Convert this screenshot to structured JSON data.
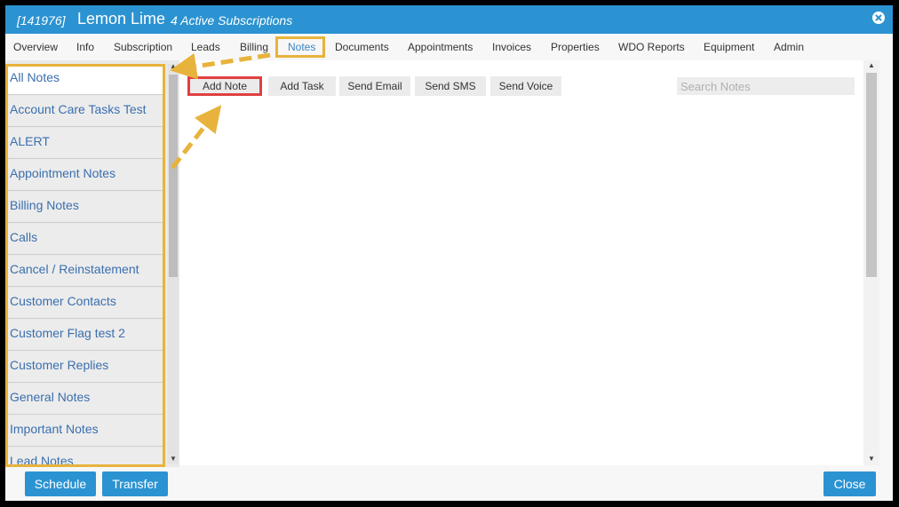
{
  "title": {
    "customer_id": "[141976]",
    "customer_name": "Lemon Lime",
    "subscriptions": "4 Active Subscriptions"
  },
  "tabs": [
    {
      "label": "Overview"
    },
    {
      "label": "Info"
    },
    {
      "label": "Subscription"
    },
    {
      "label": "Leads"
    },
    {
      "label": "Billing"
    },
    {
      "label": "Notes"
    },
    {
      "label": "Documents"
    },
    {
      "label": "Appointments"
    },
    {
      "label": "Invoices"
    },
    {
      "label": "Properties"
    },
    {
      "label": "WDO Reports"
    },
    {
      "label": "Equipment"
    },
    {
      "label": "Admin"
    }
  ],
  "sidebar": {
    "items": [
      {
        "label": "All Notes"
      },
      {
        "label": "Account Care Tasks Test"
      },
      {
        "label": "ALERT"
      },
      {
        "label": "Appointment Notes"
      },
      {
        "label": "Billing Notes"
      },
      {
        "label": "Calls"
      },
      {
        "label": "Cancel / Reinstatement"
      },
      {
        "label": "Customer Contacts"
      },
      {
        "label": "Customer Flag test 2"
      },
      {
        "label": "Customer Replies"
      },
      {
        "label": "General Notes"
      },
      {
        "label": "Important Notes"
      },
      {
        "label": "Lead Notes"
      }
    ]
  },
  "toolbar": {
    "add_note": "Add Note",
    "add_task": "Add Task",
    "send_email": "Send Email",
    "send_sms": "Send SMS",
    "send_voice": "Send Voice"
  },
  "search": {
    "placeholder": "Search Notes"
  },
  "footer": {
    "schedule": "Schedule",
    "transfer": "Transfer",
    "close": "Close"
  },
  "colors": {
    "header": "#2b93d1",
    "highlight": "#e8b33c",
    "add_note_outline": "#e04040",
    "link": "#3a6fae"
  }
}
